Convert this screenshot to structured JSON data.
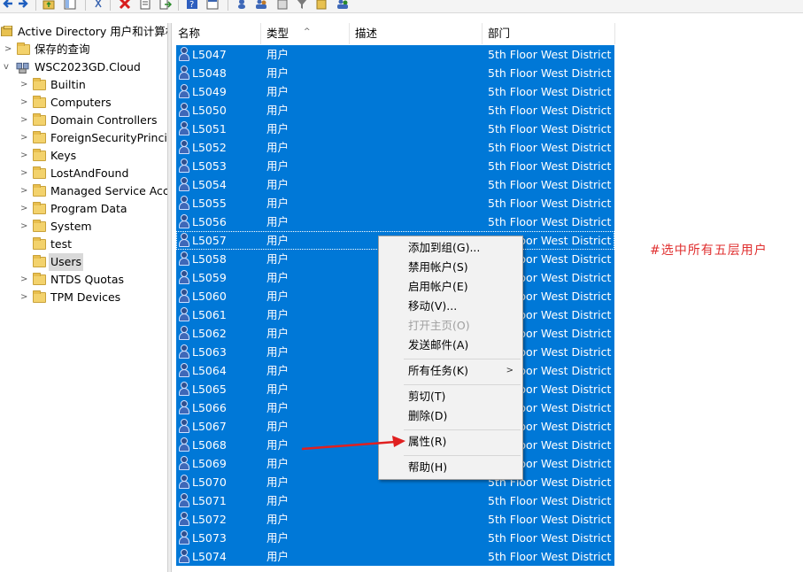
{
  "tree": {
    "root": "Active Directory 用户和计算机",
    "saved_queries": "保存的查询",
    "domain": "WSC2023GD.Cloud",
    "items": [
      {
        "label": "Builtin"
      },
      {
        "label": "Computers"
      },
      {
        "label": "Domain Controllers"
      },
      {
        "label": "ForeignSecurityPrincipa"
      },
      {
        "label": "Keys"
      },
      {
        "label": "LostAndFound"
      },
      {
        "label": "Managed Service Acco"
      },
      {
        "label": "Program Data"
      },
      {
        "label": "System"
      },
      {
        "label": "test"
      },
      {
        "label": "Users"
      },
      {
        "label": "NTDS Quotas"
      },
      {
        "label": "TPM Devices"
      }
    ]
  },
  "columns": {
    "name": "名称",
    "type": "类型",
    "desc": "描述",
    "dept": "部门"
  },
  "rows": [
    {
      "name": "L5047",
      "type": "用户",
      "dept": "5th Floor West District"
    },
    {
      "name": "L5048",
      "type": "用户",
      "dept": "5th Floor West District"
    },
    {
      "name": "L5049",
      "type": "用户",
      "dept": "5th Floor West District"
    },
    {
      "name": "L5050",
      "type": "用户",
      "dept": "5th Floor West District"
    },
    {
      "name": "L5051",
      "type": "用户",
      "dept": "5th Floor West District"
    },
    {
      "name": "L5052",
      "type": "用户",
      "dept": "5th Floor West District"
    },
    {
      "name": "L5053",
      "type": "用户",
      "dept": "5th Floor West District"
    },
    {
      "name": "L5054",
      "type": "用户",
      "dept": "5th Floor West District"
    },
    {
      "name": "L5055",
      "type": "用户",
      "dept": "5th Floor West District"
    },
    {
      "name": "L5056",
      "type": "用户",
      "dept": "5th Floor West District"
    },
    {
      "name": "L5057",
      "type": "用户",
      "dept": "5th Floor West District"
    },
    {
      "name": "L5058",
      "type": "用户",
      "dept": "5th Floor West District"
    },
    {
      "name": "L5059",
      "type": "用户",
      "dept": "5th Floor West District"
    },
    {
      "name": "L5060",
      "type": "用户",
      "dept": "5th Floor West District"
    },
    {
      "name": "L5061",
      "type": "用户",
      "dept": "5th Floor West District"
    },
    {
      "name": "L5062",
      "type": "用户",
      "dept": "5th Floor West District"
    },
    {
      "name": "L5063",
      "type": "用户",
      "dept": "5th Floor West District"
    },
    {
      "name": "L5064",
      "type": "用户",
      "dept": "5th Floor West District"
    },
    {
      "name": "L5065",
      "type": "用户",
      "dept": "5th Floor West District"
    },
    {
      "name": "L5066",
      "type": "用户",
      "dept": "5th Floor West District"
    },
    {
      "name": "L5067",
      "type": "用户",
      "dept": "5th Floor West District"
    },
    {
      "name": "L5068",
      "type": "用户",
      "dept": "5th Floor West District"
    },
    {
      "name": "L5069",
      "type": "用户",
      "dept": "5th Floor West District"
    },
    {
      "name": "L5070",
      "type": "用户",
      "dept": "5th Floor West District"
    },
    {
      "name": "L5071",
      "type": "用户",
      "dept": "5th Floor West District"
    },
    {
      "name": "L5072",
      "type": "用户",
      "dept": "5th Floor West District"
    },
    {
      "name": "L5073",
      "type": "用户",
      "dept": "5th Floor West District"
    },
    {
      "name": "L5074",
      "type": "用户",
      "dept": "5th Floor West District"
    }
  ],
  "context_menu": {
    "add_to_group": "添加到组(G)...",
    "disable_account": "禁用帐户(S)",
    "enable_account": "启用帐户(E)",
    "move": "移动(V)...",
    "open_home_page": "打开主页(O)",
    "send_mail": "发送邮件(A)",
    "all_tasks": "所有任务(K)",
    "cut": "剪切(T)",
    "delete": "删除(D)",
    "properties": "属性(R)",
    "help": "帮助(H)"
  },
  "annotation": "#选中所有五层用户",
  "colors": {
    "selection": "#0078d7",
    "annotation": "#e03030",
    "arrow": "#e02020"
  }
}
